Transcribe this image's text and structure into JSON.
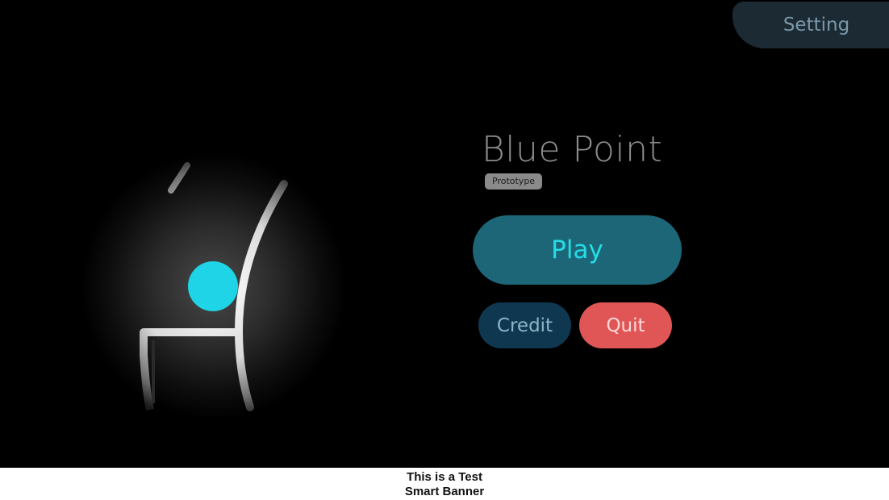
{
  "header": {
    "setting_label": "Setting"
  },
  "menu": {
    "title": "Blue Point",
    "badge": "Prototype",
    "play_label": "Play",
    "credit_label": "Credit",
    "quit_label": "Quit"
  },
  "banner": {
    "line1": "This is a Test",
    "line2": "Smart Banner"
  },
  "colors": {
    "play_button": "#1c6678",
    "play_text": "#26dce6",
    "credit_button": "#0f3850",
    "quit_button": "#e05656",
    "player_point": "#1fd4e6"
  }
}
